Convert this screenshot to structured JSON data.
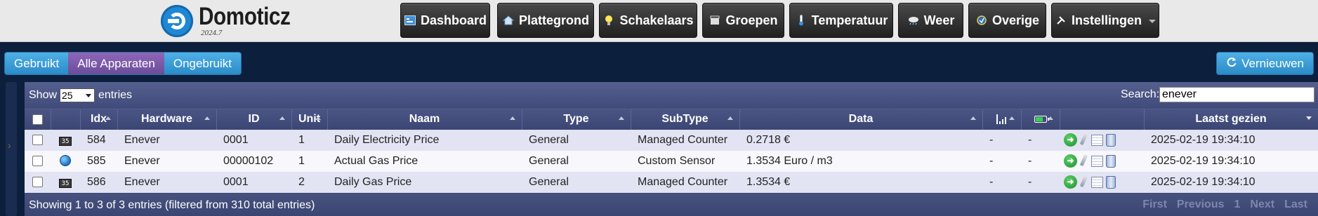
{
  "app": {
    "name": "Domoticz",
    "version": "2024.7"
  },
  "nav": {
    "items": [
      {
        "label": "Dashboard",
        "icon": "dashboard-icon"
      },
      {
        "label": "Plattegrond",
        "icon": "house-icon"
      },
      {
        "label": "Schakelaars",
        "icon": "lightbulb-icon"
      },
      {
        "label": "Groepen",
        "icon": "scenes-icon"
      },
      {
        "label": "Temperatuur",
        "icon": "thermometer-icon"
      },
      {
        "label": "Weer",
        "icon": "weather-icon"
      },
      {
        "label": "Overige",
        "icon": "utility-icon"
      },
      {
        "label": "Instellingen",
        "icon": "tools-icon"
      }
    ]
  },
  "filters": {
    "used": "Gebruikt",
    "all": "Alle Apparaten",
    "unused": "Ongebruikt",
    "active": "Alle Apparaten"
  },
  "refresh_label": "Vernieuwen",
  "table_controls": {
    "show_label": "Show",
    "page_size": "25",
    "entries_label": "entries",
    "search_label": "Search:",
    "search_value": "enever"
  },
  "columns": {
    "idx": "Idx",
    "hardware": "Hardware",
    "id": "ID",
    "unit": "Unit",
    "name": "Naam",
    "type": "Type",
    "subtype": "SubType",
    "data": "Data",
    "last_seen": "Laatst gezien"
  },
  "rows": [
    {
      "idx": "584",
      "hardware": "Enever",
      "id": "0001",
      "unit": "1",
      "name": "Daily Electricity Price",
      "type": "General",
      "subtype": "Managed Counter",
      "data": "0.2718 €",
      "signal": "-",
      "battery": "-",
      "last_seen": "2025-02-19 19:34:10",
      "icon": "counter-icon",
      "counter_text": "35"
    },
    {
      "idx": "585",
      "hardware": "Enever",
      "id": "00000102",
      "unit": "1",
      "name": "Actual Gas Price",
      "type": "General",
      "subtype": "Custom Sensor",
      "data": "1.3534 Euro / m3",
      "signal": "-",
      "battery": "-",
      "last_seen": "2025-02-19 19:34:10",
      "icon": "globe-icon"
    },
    {
      "idx": "586",
      "hardware": "Enever",
      "id": "0001",
      "unit": "2",
      "name": "Daily Gas Price",
      "type": "General",
      "subtype": "Managed Counter",
      "data": "1.3534 €",
      "signal": "-",
      "battery": "-",
      "last_seen": "2025-02-19 19:34:10",
      "icon": "counter-icon",
      "counter_text": "35"
    }
  ],
  "footer": {
    "info": "Showing 1 to 3 of 3 entries (filtered from 310 total entries)",
    "pager": {
      "first": "First",
      "previous": "Previous",
      "page": "1",
      "next": "Next",
      "last": "Last"
    }
  }
}
